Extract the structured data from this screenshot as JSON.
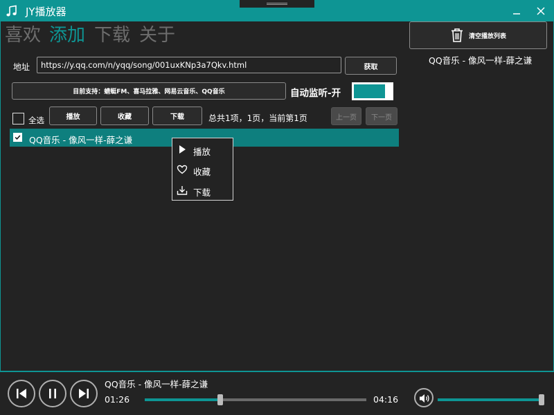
{
  "window": {
    "title": "JY播放器",
    "app_icon": "music-note-icon",
    "accent_color": "#0e9594"
  },
  "nav": {
    "tabs": [
      {
        "label": "喜欢",
        "active": false
      },
      {
        "label": "添加",
        "active": true
      },
      {
        "label": "下载",
        "active": false
      },
      {
        "label": "关于",
        "active": false
      }
    ]
  },
  "add_page": {
    "address_label": "地址",
    "address_value": "https://y.qq.com/n/yqq/song/001uxKNp3a7Qkv.html",
    "fetch_label": "获取",
    "support_label": "目前支持：蜻蜓FM、喜马拉雅、网易云音乐、QQ音乐",
    "auto_monitor_label": "自动监听-开",
    "auto_monitor_on": true,
    "select_all_label": "全选",
    "play_label": "播放",
    "favorite_label": "收藏",
    "download_label": "下载",
    "page_summary": "总共1项，1页，当前第1页",
    "prev_page_label": "上一页",
    "next_page_label": "下一页",
    "songs": [
      {
        "title": "QQ音乐 - 像风一样-薛之谦",
        "checked": true
      }
    ]
  },
  "context_menu": {
    "items": [
      {
        "label": "播放",
        "icon": "play-icon"
      },
      {
        "label": "收藏",
        "icon": "heart-icon"
      },
      {
        "label": "下载",
        "icon": "download-icon"
      }
    ]
  },
  "playlist": {
    "clear_label": "清空播放列表",
    "items": [
      "QQ音乐 - 像风一样-薛之谦"
    ]
  },
  "player": {
    "now_playing": "QQ音乐 - 像风一样-薛之谦",
    "elapsed": "01:26",
    "total": "04:16",
    "progress_fraction": 0.34,
    "volume_fraction": 1.0
  }
}
